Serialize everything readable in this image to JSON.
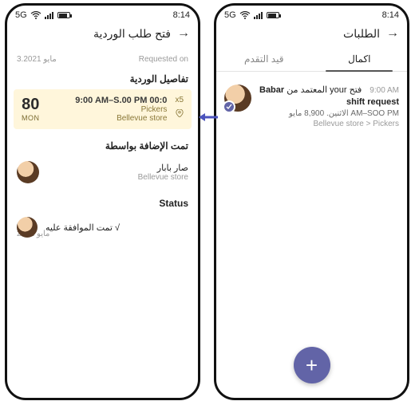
{
  "status": {
    "time": "8:14",
    "network": "5G"
  },
  "right": {
    "title": "الطلبات",
    "tabs": {
      "active": "اكمال",
      "inactive": "قيد التقدم"
    },
    "item": {
      "time": "9:00 AM",
      "line1_prefix": "فتح your المعتمد من",
      "line1_name": "Babar",
      "subject": "shift request",
      "details": "الاثنين. 8,900 مايو AM–SOO PM",
      "crumb": "Bellevue store > Pickers"
    },
    "fab": "+"
  },
  "left": {
    "title": "فتح طلب الوردية",
    "requested_label": "Requested on",
    "requested_value": "3.2021 مايو",
    "section_shift": "تفاصيل الوردية",
    "shift": {
      "dayNum": "80",
      "dayDow": "MON",
      "time": "9:00 AM–S.00 PM 00:0",
      "role": "Pickers",
      "store": "Bellevue store",
      "count": "x5"
    },
    "section_assigned": "تمت الإضافة بواسطة",
    "assigner": {
      "name": "صار بابار",
      "store": "Bellevue store"
    },
    "section_status": "Status",
    "status_text": "√ تمت الموافقة عليه",
    "status_date": "مايو 2021"
  }
}
